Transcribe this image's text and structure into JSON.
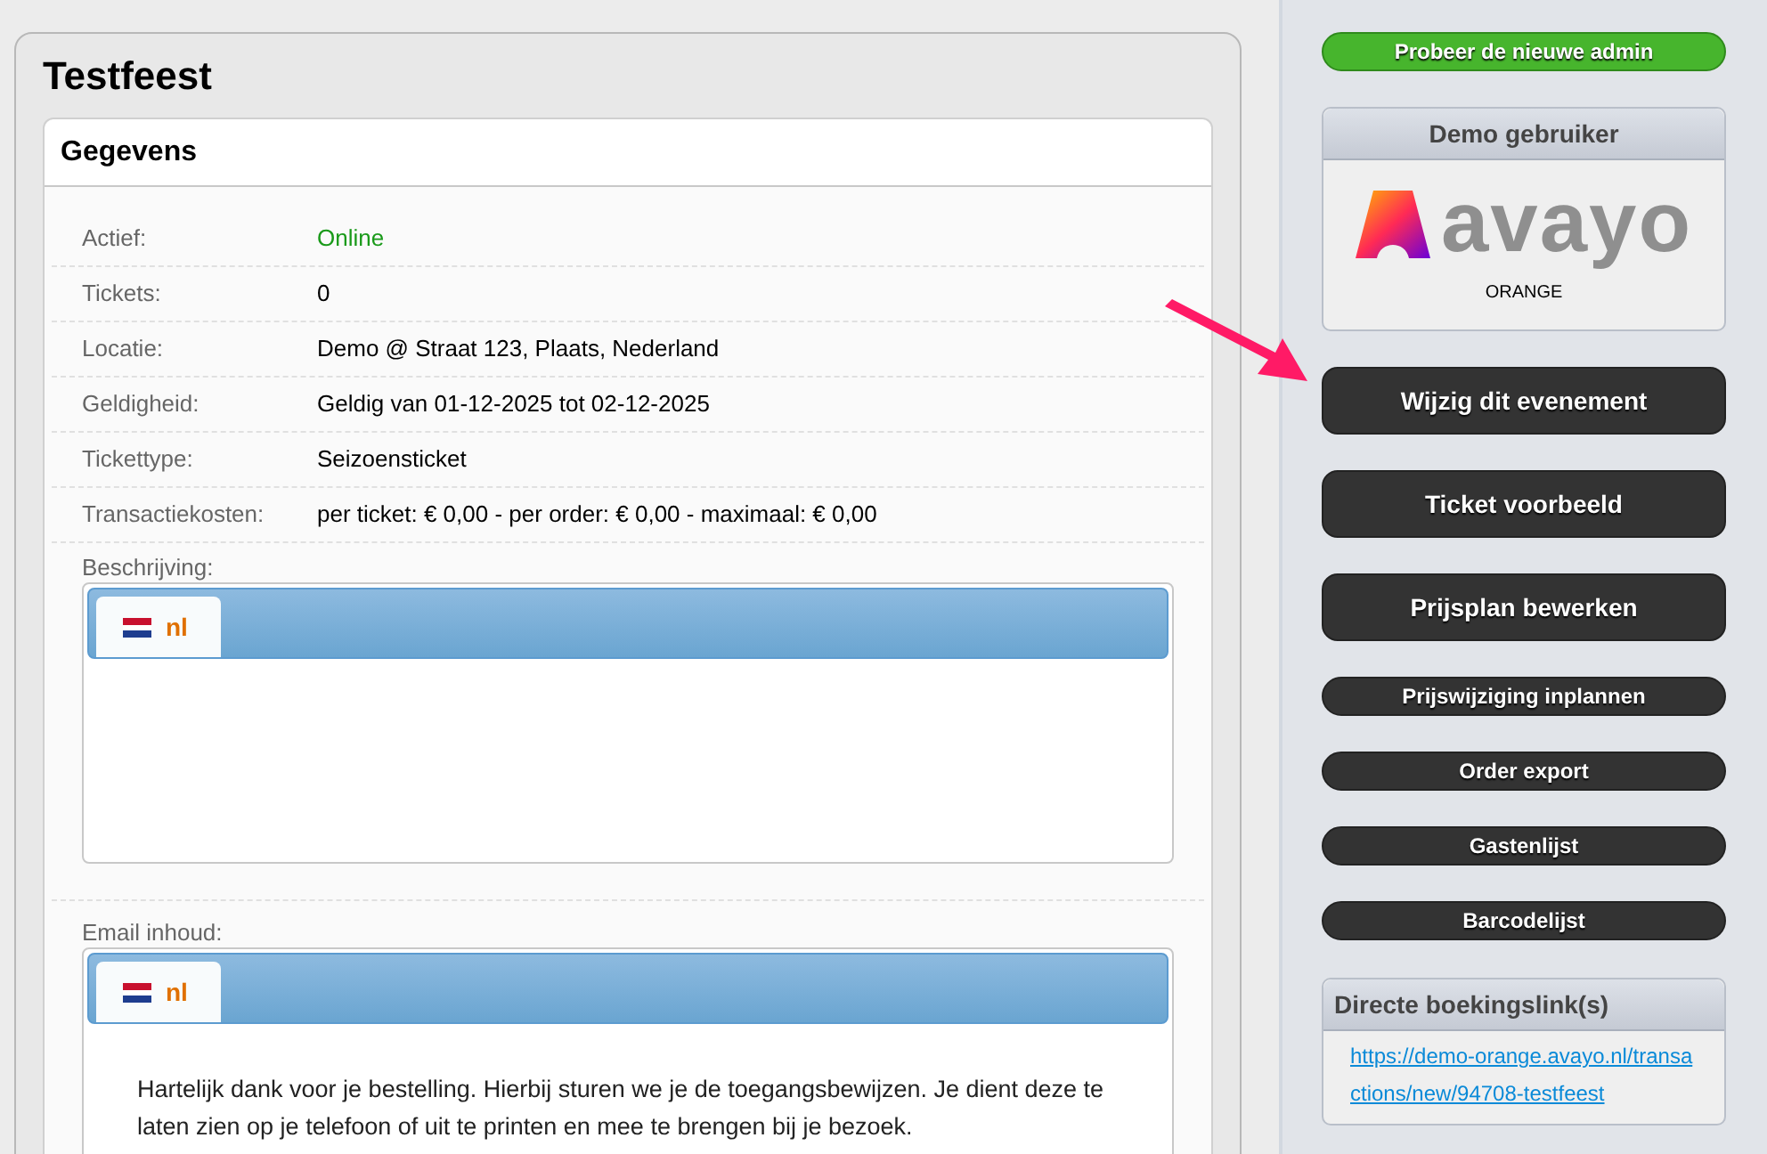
{
  "page_title": "Testfeest",
  "card": {
    "title": "Gegevens",
    "fields": [
      {
        "label": "Actief:",
        "value": "Online",
        "kind": "status"
      },
      {
        "label": "Tickets:",
        "value": "0",
        "kind": "text"
      },
      {
        "label": "Locatie:",
        "value": "Demo @ Straat 123, Plaats, Nederland",
        "kind": "text"
      },
      {
        "label": "Geldigheid:",
        "value": "Geldig van 01-12-2025 tot 02-12-2025",
        "kind": "text"
      },
      {
        "label": "Tickettype:",
        "value": "Seizoensticket",
        "kind": "text"
      },
      {
        "label": "Transactiekosten:",
        "value": "per ticket: € 0,00 - per order: € 0,00 - maximaal: € 0,00",
        "kind": "text"
      }
    ],
    "editors": [
      {
        "label": "Beschrijving:",
        "tab": "nl"
      },
      {
        "label": "Email inhoud:",
        "tab": "nl",
        "content": "Hartelijk dank voor je bestelling. Hierbij sturen we je de toegangsbewijzen. Je dient deze te laten zien op je telefoon of uit te printen en mee te brengen bij je bezoek."
      }
    ]
  },
  "sidebar": {
    "top_button": "Probeer de nieuwe admin",
    "account": {
      "title": "Demo gebruiker",
      "logo_text": "avayo",
      "name": "ORANGE"
    },
    "buttons": [
      {
        "label": "Wijzig dit evenement",
        "kind": "large"
      },
      {
        "label": "Ticket voorbeeld",
        "kind": "large"
      },
      {
        "label": "Prijsplan bewerken",
        "kind": "large"
      },
      {
        "label": "Prijswijziging inplannen",
        "kind": "small"
      },
      {
        "label": "Order export",
        "kind": "small"
      },
      {
        "label": "Gastenlijst",
        "kind": "small"
      },
      {
        "label": "Barcodelijst",
        "kind": "small"
      }
    ],
    "links_box": {
      "title": "Directe boekingslink(s)",
      "links": [
        "https://demo-orange.avayo.nl/transactions/new/94708-testfeest"
      ]
    }
  }
}
